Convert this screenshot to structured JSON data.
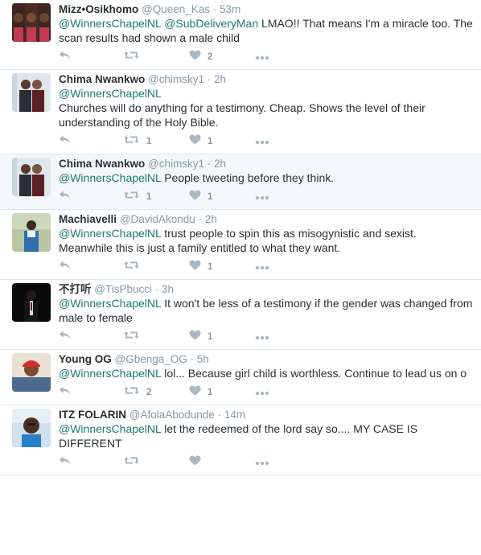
{
  "tweets": [
    {
      "name": "Mizz•Osikhomo",
      "handle": "@Queen_Kas",
      "time": "53m",
      "body": [
        {
          "m": true,
          "t": "@WinnersChapelNL"
        },
        {
          "m": false,
          "t": " "
        },
        {
          "m": true,
          "t": "@SubDeliveryMan"
        },
        {
          "m": false,
          "t": " LMAO!! That means I'm a miracle too. The scan results had shown a male child"
        }
      ],
      "retweets": "",
      "likes": "2",
      "highlight": false
    },
    {
      "name": "Chima Nwankwo",
      "handle": "@chimsky1",
      "time": "2h",
      "body": [
        {
          "m": true,
          "t": "@WinnersChapelNL"
        },
        {
          "m": false,
          "t": "\nChurches will do anything for a testimony. Cheap. Shows the level of their understanding of the Holy Bible."
        }
      ],
      "retweets": "1",
      "likes": "1",
      "highlight": false
    },
    {
      "name": "Chima Nwankwo",
      "handle": "@chimsky1",
      "time": "2h",
      "body": [
        {
          "m": true,
          "t": "@WinnersChapelNL"
        },
        {
          "m": false,
          "t": " People tweeting before they think."
        }
      ],
      "retweets": "1",
      "likes": "1",
      "highlight": true
    },
    {
      "name": "Machiavelli",
      "handle": "@DavidAkondu",
      "time": "2h",
      "body": [
        {
          "m": true,
          "t": "@WinnersChapelNL"
        },
        {
          "m": false,
          "t": " trust people to spin this as misogynistic and sexist. Meanwhile this is just a family entitled to what they want."
        }
      ],
      "retweets": "",
      "likes": "1",
      "highlight": false
    },
    {
      "name": "不打听",
      "handle": "@TisPbucci",
      "time": "3h",
      "body": [
        {
          "m": true,
          "t": "@WinnersChapelNL"
        },
        {
          "m": false,
          "t": " It won't be less of a testimony if the gender was changed from male to female"
        }
      ],
      "retweets": "",
      "likes": "1",
      "highlight": false
    },
    {
      "name": "Young OG",
      "handle": "@Gbenga_OG",
      "time": "5h",
      "body": [
        {
          "m": true,
          "t": "@WinnersChapelNL"
        },
        {
          "m": false,
          "t": " lol... Because girl child is worthless. Continue to lead us on o"
        }
      ],
      "retweets": "2",
      "likes": "1",
      "highlight": false
    },
    {
      "name": "ITZ FOLARIN",
      "handle": "@AfolaAbodunde",
      "time": "14m",
      "body": [
        {
          "m": true,
          "t": "@WinnersChapelNL"
        },
        {
          "m": false,
          "t": " let the redeemed of the lord say so.... MY CASE IS DIFFERENT"
        }
      ],
      "retweets": "",
      "likes": "",
      "highlight": false
    }
  ],
  "separator": "·",
  "colors": {
    "mention": "#1b7a70",
    "icon": "#aab8c2",
    "meta": "#8899a6",
    "border": "#e1e8ed",
    "highlight_bg": "#f5f8fa"
  },
  "icons": {
    "reply": "reply-icon",
    "retweet": "retweet-icon",
    "like": "heart-icon",
    "more": "more-icon"
  }
}
